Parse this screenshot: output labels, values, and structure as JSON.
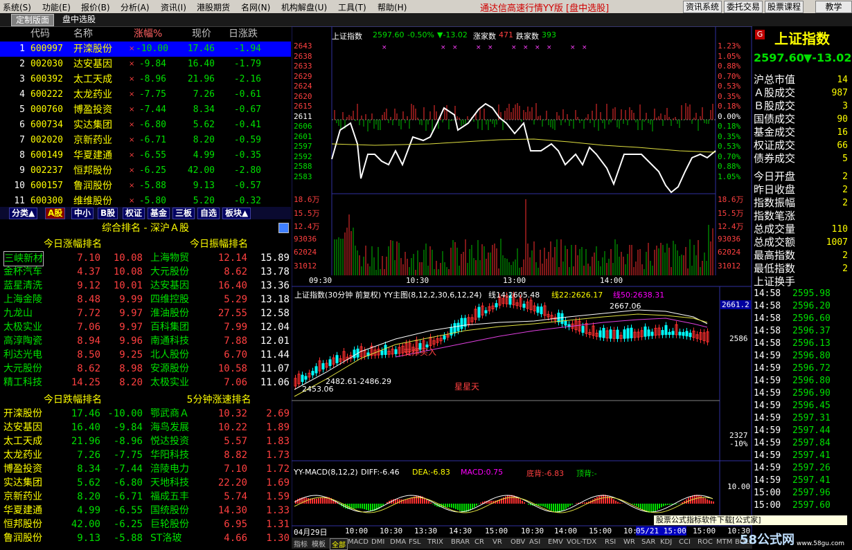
{
  "menu": [
    "系统(S)",
    "功能(E)",
    "报价(B)",
    "分析(A)",
    "资讯(I)",
    "港股期货",
    "名网(N)",
    "机构解盘(U)",
    "工具(T)",
    "帮助(H)"
  ],
  "app_title": "通达信高速行情YY版 [盘中选股]",
  "sys_buttons": [
    "资讯系统",
    "委托交易",
    "股票课程",
    "教学"
  ],
  "tabs": [
    "定制版面",
    "盘中选股"
  ],
  "list_headers": [
    "代码",
    "名称",
    "涨幅%",
    "现价",
    "日涨跌"
  ],
  "stocks": [
    {
      "n": "1",
      "code": "600997",
      "name": "开滦股份",
      "pct": "-10.00",
      "price": "17.46",
      "chg": "-1.94"
    },
    {
      "n": "2",
      "code": "002030",
      "name": "达安基因",
      "pct": "-9.84",
      "price": "16.40",
      "chg": "-1.79"
    },
    {
      "n": "3",
      "code": "600392",
      "name": "太工天成",
      "pct": "-8.96",
      "price": "21.96",
      "chg": "-2.16"
    },
    {
      "n": "4",
      "code": "600222",
      "name": "太龙药业",
      "pct": "-7.75",
      "price": "7.26",
      "chg": "-0.61"
    },
    {
      "n": "5",
      "code": "000760",
      "name": "博盈投资",
      "pct": "-7.44",
      "price": "8.34",
      "chg": "-0.67"
    },
    {
      "n": "6",
      "code": "600734",
      "name": "实达集团",
      "pct": "-6.80",
      "price": "5.62",
      "chg": "-0.41"
    },
    {
      "n": "7",
      "code": "002020",
      "name": "京新药业",
      "pct": "-6.71",
      "price": "8.20",
      "chg": "-0.59"
    },
    {
      "n": "8",
      "code": "600149",
      "name": "华夏建通",
      "pct": "-6.55",
      "price": "4.99",
      "chg": "-0.35"
    },
    {
      "n": "9",
      "code": "002237",
      "name": "恒邦股份",
      "pct": "-6.25",
      "price": "42.00",
      "chg": "-2.80"
    },
    {
      "n": "10",
      "code": "600157",
      "name": "鲁润股份",
      "pct": "-5.88",
      "price": "9.13",
      "chg": "-0.57"
    },
    {
      "n": "11",
      "code": "600300",
      "name": "维维股份",
      "pct": "-5.80",
      "price": "5.20",
      "chg": "-0.32"
    }
  ],
  "categories": [
    "分类▲",
    "A股",
    "中小",
    "B股",
    "权证",
    "基金",
    "三板",
    "自选",
    "板块▲"
  ],
  "rank_title": "综合排名 - 深沪Ａ股",
  "sections": {
    "gain": {
      "title": "今日涨幅排名",
      "rows": [
        [
          "三峡新材",
          "7.10",
          "10.08"
        ],
        [
          "金杯汽车",
          "4.37",
          "10.08"
        ],
        [
          "蓝星清洗",
          "9.12",
          "10.01"
        ],
        [
          "上海金陵",
          "8.48",
          "9.99"
        ],
        [
          "九龙山",
          "7.72",
          "9.97"
        ],
        [
          "太极实业",
          "7.06",
          "9.97"
        ],
        [
          "高淳陶瓷",
          "8.94",
          "9.96"
        ],
        [
          "利达光电",
          "8.50",
          "9.25"
        ],
        [
          "大元股份",
          "8.62",
          "8.98"
        ],
        [
          "精工科技",
          "14.25",
          "8.20"
        ]
      ]
    },
    "amp": {
      "title": "今日振幅排名",
      "rows": [
        [
          "上海物贸",
          "12.14",
          "15.89"
        ],
        [
          "大元股份",
          "8.62",
          "13.78"
        ],
        [
          "达安基因",
          "16.40",
          "13.36"
        ],
        [
          "四维控股",
          "5.29",
          "13.18"
        ],
        [
          "淮油股份",
          "27.55",
          "12.58"
        ],
        [
          "百科集团",
          "7.99",
          "12.04"
        ],
        [
          "南通科技",
          "7.88",
          "12.01"
        ],
        [
          "北人股份",
          "6.70",
          "11.44"
        ],
        [
          "安源股份",
          "10.58",
          "11.07"
        ],
        [
          "太极实业",
          "7.06",
          "11.06"
        ]
      ]
    },
    "loss": {
      "title": "今日跌幅排名",
      "rows": [
        [
          "开滦股份",
          "17.46",
          "-10.00"
        ],
        [
          "达安基因",
          "16.40",
          "-9.84"
        ],
        [
          "太工天成",
          "21.96",
          "-8.96"
        ],
        [
          "太龙药业",
          "7.26",
          "-7.75"
        ],
        [
          "博盈投资",
          "8.34",
          "-7.44"
        ],
        [
          "实达集团",
          "5.62",
          "-6.80"
        ],
        [
          "京新药业",
          "8.20",
          "-6.71"
        ],
        [
          "华夏建通",
          "4.99",
          "-6.55"
        ],
        [
          "恒邦股份",
          "42.00",
          "-6.25"
        ],
        [
          "鲁润股份",
          "9.13",
          "-5.88"
        ]
      ]
    },
    "speed": {
      "title": "5分钟涨速排名",
      "rows": [
        [
          "鄂武商Ａ",
          "10.32",
          "2.69"
        ],
        [
          "海鸟发展",
          "10.22",
          "1.89"
        ],
        [
          "悦达投资",
          "5.57",
          "1.83"
        ],
        [
          "华阳科技",
          "8.82",
          "1.73"
        ],
        [
          "涪陵电力",
          "7.10",
          "1.72"
        ],
        [
          "天地科技",
          "22.20",
          "1.69"
        ],
        [
          "福成五丰",
          "5.74",
          "1.59"
        ],
        [
          "国统股份",
          "14.30",
          "1.33"
        ],
        [
          "巨轮股份",
          "6.95",
          "1.31"
        ],
        [
          "ST洛玻",
          "4.66",
          "1.30"
        ]
      ]
    }
  },
  "intraday": {
    "label": "上证指数",
    "last": "2597.60",
    "pct": "-0.50%",
    "chg": "▼-13.02",
    "up_label": "涨家数",
    "up": "471",
    "down_label": "跌家数",
    "down": "393",
    "y_left": [
      "2643",
      "2638",
      "2633",
      "2629",
      "2624",
      "2620",
      "2615",
      "2611",
      "2606",
      "2601",
      "2597",
      "2592",
      "2588",
      "2583"
    ],
    "y_right": [
      "1.23%",
      "1.05%",
      "0.88%",
      "0.70%",
      "0.53%",
      "0.35%",
      "0.18%",
      "0.00%",
      "0.18%",
      "0.35%",
      "0.53%",
      "0.70%",
      "0.88%",
      "1.05%"
    ],
    "vol_left": [
      "18.6万",
      "15.5万",
      "12.4万",
      "93036",
      "62024",
      "31012"
    ],
    "vol_right": [
      "18.6万",
      "15.5万",
      "12.4万",
      "93036",
      "62024",
      "31012"
    ],
    "times": [
      "09:30",
      "10:30",
      "13:00",
      "14:00"
    ]
  },
  "kline": {
    "title": "上证指数(30分钟 前复权) YY主图(8,12,2,30,6,12,24)",
    "ma14": "线14:2605.48",
    "ma22": "线22:2626.17",
    "ma50": "线50:2638.31",
    "high_lbl": "2667.06",
    "low_lbl1": "2482.61-2486.29",
    "low_lbl2": "2453.06",
    "buy_txt": "支撑买入",
    "star_txt": "星星天",
    "right_axis": [
      "2661.2",
      "2586",
      "2327",
      "-10%"
    ]
  },
  "macd": {
    "title": "YY-MACD(8,12,2)",
    "diff": "DIFF:-6.46",
    "dea": "DEA:-6.83",
    "macd": "MACD:0.75",
    "di": "底背:-6.83",
    "ding": "顶背:-",
    "level": "10.00"
  },
  "date_axis": [
    "04月29日",
    "10:00",
    "10:30",
    "13:30",
    "14:30",
    "15:00",
    "10:30",
    "14:00",
    "15:00",
    "10:30",
    "14:00",
    "15:00",
    "10:30",
    "05/21 15:00"
  ],
  "bottom_tabs": [
    "指标",
    "模板",
    "全部",
    "MACD",
    "DMI",
    "DMA",
    "FSL",
    "TRIX",
    "BRAR",
    "CR",
    "VR",
    "OBV",
    "ASI",
    "EMV",
    "VOL-TDX",
    "RSI",
    "WR",
    "SAR",
    "KDJ",
    "CCI",
    "ROC",
    "MTM",
    "BOLL"
  ],
  "index_panel": {
    "name": "上证指数",
    "last": "2597.60",
    "chg": "▼-13.02",
    "rows": [
      [
        "沪总市值",
        "14"
      ],
      [
        "Ａ股成交",
        "987"
      ],
      [
        "Ｂ股成交",
        "3"
      ],
      [
        "国债成交",
        "90"
      ],
      [
        "基金成交",
        "16"
      ],
      [
        "权证成交",
        "66"
      ],
      [
        "债券成交",
        "5"
      ],
      [
        "今日开盘",
        "2"
      ],
      [
        "昨日收盘",
        "2"
      ],
      [
        "指数振幅",
        "2"
      ],
      [
        "指数笔涨",
        ""
      ],
      [
        "总成交量",
        "110"
      ],
      [
        "总成交额",
        "1007"
      ],
      [
        "最高指数",
        "2"
      ],
      [
        "最低指数",
        "2"
      ],
      [
        "上证换手",
        ""
      ]
    ],
    "ticks": [
      [
        "14:58",
        "2595.98"
      ],
      [
        "14:58",
        "2596.20"
      ],
      [
        "14:58",
        "2596.60"
      ],
      [
        "14:58",
        "2596.37"
      ],
      [
        "14:58",
        "2596.13"
      ],
      [
        "14:59",
        "2596.80"
      ],
      [
        "14:59",
        "2596.72"
      ],
      [
        "14:59",
        "2596.80"
      ],
      [
        "14:59",
        "2596.90"
      ],
      [
        "14:59",
        "2596.45"
      ],
      [
        "14:59",
        "2597.31"
      ],
      [
        "14:59",
        "2597.44"
      ],
      [
        "14:59",
        "2597.84"
      ],
      [
        "14:59",
        "2597.41"
      ],
      [
        "14:59",
        "2597.26"
      ],
      [
        "14:59",
        "2597.41"
      ],
      [
        "15:00",
        "2597.96"
      ],
      [
        "15:00",
        "2597.60"
      ]
    ]
  },
  "watermark": "58公式网",
  "watermark_url": "www.58gu.com",
  "promo": "股票公式指标软件下载[公式家]"
}
